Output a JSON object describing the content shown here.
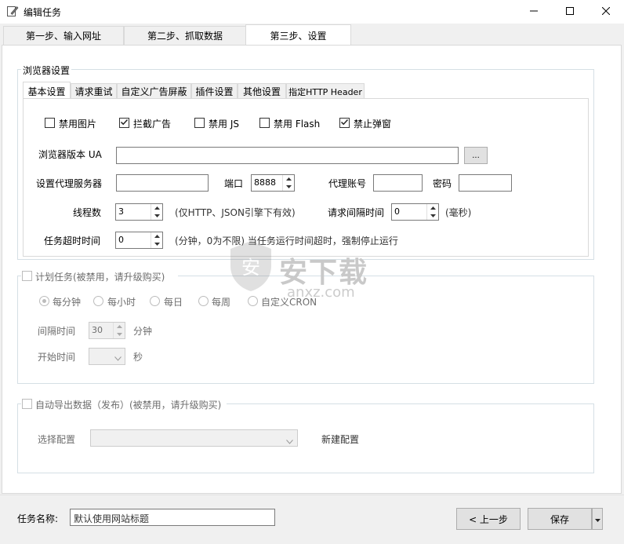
{
  "window": {
    "title": "编辑任务"
  },
  "top_tabs": [
    {
      "label": "第一步、输入网址"
    },
    {
      "label": "第二步、抓取数据"
    },
    {
      "label": "第三步、设置"
    }
  ],
  "browser_settings": {
    "group_title": "浏览器设置",
    "tabs": [
      {
        "label": "基本设置"
      },
      {
        "label": "请求重试"
      },
      {
        "label": "自定义广告屏蔽"
      },
      {
        "label": "插件设置"
      },
      {
        "label": "其他设置"
      },
      {
        "label": "指定HTTP Header"
      }
    ],
    "checkboxes": [
      {
        "label": "禁用图片",
        "checked": false
      },
      {
        "label": "拦截广告",
        "checked": true
      },
      {
        "label": "禁用 JS",
        "checked": false
      },
      {
        "label": "禁用 Flash",
        "checked": false
      },
      {
        "label": "禁止弹窗",
        "checked": true
      }
    ],
    "ua_label": "浏览器版本 UA",
    "ua_value": "",
    "ua_button": "...",
    "proxy_label": "设置代理服务器",
    "proxy_value": "",
    "port_label": "端口",
    "port_value": "8888",
    "proxy_account_label": "代理账号",
    "proxy_account_value": "",
    "password_label": "密码",
    "password_value": "",
    "threads_label": "线程数",
    "threads_value": "3",
    "threads_note": "(仅HTTP、JSON引擎下有效)",
    "interval_label": "请求间隔时间",
    "interval_value": "0",
    "interval_unit": "(毫秒)",
    "timeout_label": "任务超时时间",
    "timeout_value": "0",
    "timeout_note": "(分钟，0为不限) 当任务运行时间超时，强制停止运行"
  },
  "schedule": {
    "title": "计划任务(被禁用，请升级购买)",
    "radios": [
      {
        "label": "每分钟",
        "selected": true
      },
      {
        "label": "每小时",
        "selected": false
      },
      {
        "label": "每日",
        "selected": false
      },
      {
        "label": "每周",
        "selected": false
      },
      {
        "label": "自定义CRON",
        "selected": false
      }
    ],
    "interval_label": "间隔时间",
    "interval_value": "30",
    "interval_unit": "分钟",
    "start_label": "开始时间",
    "start_unit": "秒"
  },
  "export": {
    "title": "自动导出数据（发布）(被禁用，请升级购买)",
    "config_label": "选择配置",
    "new_config": "新建配置"
  },
  "watermark": {
    "text": "安下载",
    "sub": "anxz.com"
  },
  "footer": {
    "task_name_label": "任务名称:",
    "task_name_value": "默认使用网站标题",
    "prev_button": "< 上一步",
    "save_button": "保存"
  }
}
